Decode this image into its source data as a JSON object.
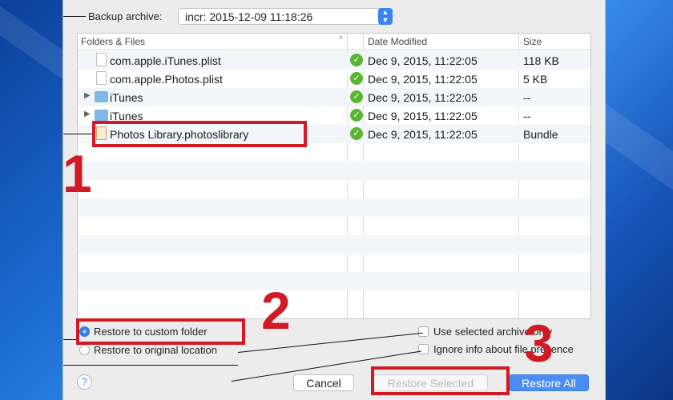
{
  "backup_archive": {
    "label": "Backup archive:",
    "value": "incr: 2015-12-09 11:18:26"
  },
  "table": {
    "columns": [
      "Folders & Files",
      "Date Modified",
      "Size"
    ],
    "rows": [
      {
        "name": "com.apple.iTunes.plist",
        "kind": "file",
        "date": "Dec 9, 2015, 11:22:05",
        "size": "118 KB"
      },
      {
        "name": "com.apple.Photos.plist",
        "kind": "file",
        "date": "Dec 9, 2015, 11:22:05",
        "size": "5 KB"
      },
      {
        "name": "iTunes",
        "kind": "folder",
        "date": "Dec 9, 2015, 11:22:05",
        "size": "--"
      },
      {
        "name": "iTunes",
        "kind": "folder",
        "date": "Dec 9, 2015, 11:22:05",
        "size": "--"
      },
      {
        "name": "Photos Library.photoslibrary",
        "kind": "bundle",
        "date": "Dec 9, 2015, 11:22:05",
        "size": "Bundle"
      }
    ]
  },
  "options": {
    "restore_custom": "Restore to custom folder",
    "restore_original": "Restore to original location",
    "use_selected_only": "Use selected archive only",
    "ignore_info": "Ignore info about file presence",
    "help": "?"
  },
  "buttons": {
    "cancel": "Cancel",
    "restore_selected": "Restore Selected",
    "restore_all": "Restore All"
  },
  "annotations": {
    "step1": "1",
    "step2": "2",
    "step3": "3",
    "color": "#d11a23"
  }
}
